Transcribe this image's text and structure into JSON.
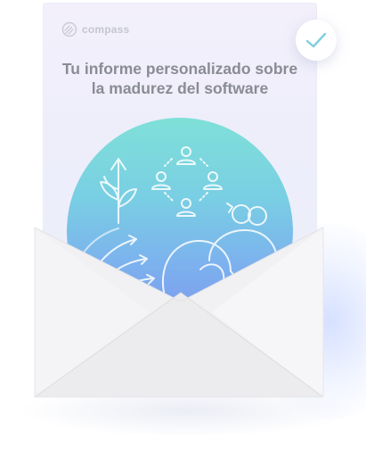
{
  "brand": {
    "name": "compass",
    "icon": "compass-logo-icon"
  },
  "report": {
    "title_line1": "Tu informe personalizado sobre",
    "title_line2": "la madurez del software"
  },
  "badge": {
    "icon": "checkmark-icon"
  },
  "colors": {
    "card_bg": "#eeeefb",
    "title": "#8a8c94",
    "circle_top": "#7fe0d8",
    "circle_bottom": "#7f8ff0",
    "check": "#7ecfe0",
    "envelope": "#f1f1f3"
  }
}
